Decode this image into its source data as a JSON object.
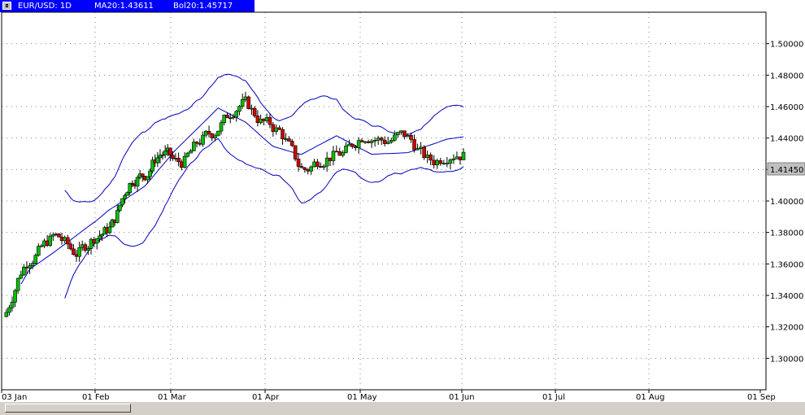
{
  "header": {
    "symbol": "EUR/USD: 1D",
    "ma_label": "MA20:1.43611",
    "bol_label": "Bol20:1.45717"
  },
  "price_badge": "1.41450",
  "colors": {
    "background": "#ffffff",
    "up_candle": "#00c000",
    "down_candle": "#d00000",
    "bands": "#0000c0",
    "grid": "#808080",
    "title_bar": "#0000ff"
  },
  "chart_data": {
    "type": "candlestick",
    "title": "EUR/USD: 1D",
    "ylim": [
      1.28,
      1.52
    ],
    "yticks": [
      "1.30000",
      "1.32000",
      "1.34000",
      "1.36000",
      "1.38000",
      "1.40000",
      "1.42000",
      "1.44000",
      "1.46000",
      "1.48000",
      "1.50000"
    ],
    "xticks": [
      "03 Jan",
      "01 Feb",
      "01 Mar",
      "01 Apr",
      "01 May",
      "01 Jun",
      "01 Jul",
      "01 Aug",
      "01 Sep"
    ],
    "grid": true,
    "last_price": 1.4145,
    "ma20": [
      [
        1.3315,
        1.3346,
        1.3378,
        1.3409,
        1.3441,
        1.3472,
        1.3503,
        1.3535,
        1.3566,
        1.3579,
        1.3592,
        1.3605,
        1.3618,
        1.3631,
        1.3644,
        1.3657,
        1.367,
        1.3684,
        1.3698,
        1.3712,
        1.3725,
        1.3739,
        1.3753,
        1.3767,
        1.3781,
        1.3795,
        1.3809,
        1.3823,
        1.3837,
        1.3851,
        1.3864,
        1.3878
      ],
      [
        1.3892,
        1.3906,
        1.392,
        1.3934,
        1.3945,
        1.3956,
        1.3966,
        1.3977,
        1.3988,
        1.3999,
        1.4009,
        1.402,
        1.4031,
        1.4042,
        1.4052,
        1.4063,
        1.4074,
        1.4085,
        1.4095,
        1.4114,
        1.4133,
        1.4152,
        1.4171,
        1.419,
        1.4209,
        1.4228,
        1.4247,
        1.4266,
        1.4285,
        1.4305
      ],
      [
        1.4324,
        1.4343,
        1.4362,
        1.4381,
        1.44,
        1.4419,
        1.4438,
        1.4457,
        1.4476,
        1.4495,
        1.4514,
        1.4533,
        1.4553,
        1.4572,
        1.4591,
        1.4581,
        1.4571,
        1.4561,
        1.4551,
        1.4541,
        1.4531,
        1.4521,
        1.4511,
        1.4501,
        1.4484,
        1.4467,
        1.445,
        1.4433,
        1.4415,
        1.4398,
        1.4381
      ],
      [
        1.4364,
        1.4347,
        1.4341,
        1.4335,
        1.4329,
        1.4323,
        1.4317,
        1.4311,
        1.4305,
        1.4299,
        1.4297,
        1.4308,
        1.4319,
        1.4329,
        1.434,
        1.4351,
        1.4361,
        1.4372,
        1.4383,
        1.4393,
        1.4404,
        1.4415,
        1.4404,
        1.4393,
        1.4383,
        1.4372,
        1.4361,
        1.4351,
        1.434,
        1.4329
      ],
      [
        1.4319,
        1.4308,
        1.4297,
        1.4298,
        1.4299,
        1.43,
        1.4301,
        1.4301,
        1.4302,
        1.4303,
        1.4304,
        1.4305,
        1.4306,
        1.4307,
        1.4314,
        1.4321,
        1.4328,
        1.4335,
        1.4343,
        1.435,
        1.4357,
        1.4364,
        1.4371,
        1.4379,
        1.4386,
        1.4393,
        1.4396,
        1.4399,
        1.4402,
        1.4405,
        1.4408
      ]
    ]
  }
}
